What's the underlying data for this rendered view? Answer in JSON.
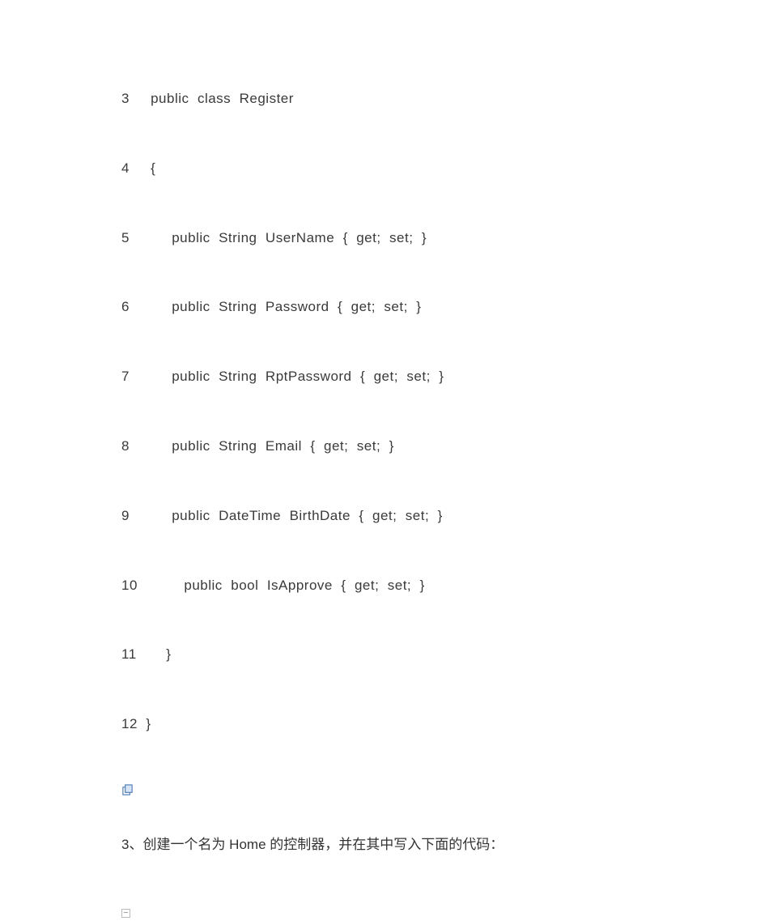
{
  "code_lines": [
    {
      "num": "3",
      "text": "     public  class  Register"
    },
    {
      "num": "4",
      "text": "     {"
    },
    {
      "num": "5",
      "text": "          public  String  UserName  {  get;  set;  }"
    },
    {
      "num": "6",
      "text": "          public  String  Password  {  get;  set;  }"
    },
    {
      "num": "7",
      "text": "          public  String  RptPassword  {  get;  set;  }"
    },
    {
      "num": "8",
      "text": "          public  String  Email  {  get;  set;  }"
    },
    {
      "num": "9",
      "text": "          public  DateTime  BirthDate  {  get;  set;  }"
    },
    {
      "num": "10",
      "text": "           public  bool  IsApprove  {  get;  set;  }"
    },
    {
      "num": "11",
      "text": "       }"
    },
    {
      "num": "12",
      "text": "  }"
    }
  ],
  "narrative": {
    "step3": "3、创建一个名为 Home 的控制器，并在其中写入下面的代码："
  },
  "icons": {
    "copy": "copy-icon",
    "collapse": "⊟"
  }
}
